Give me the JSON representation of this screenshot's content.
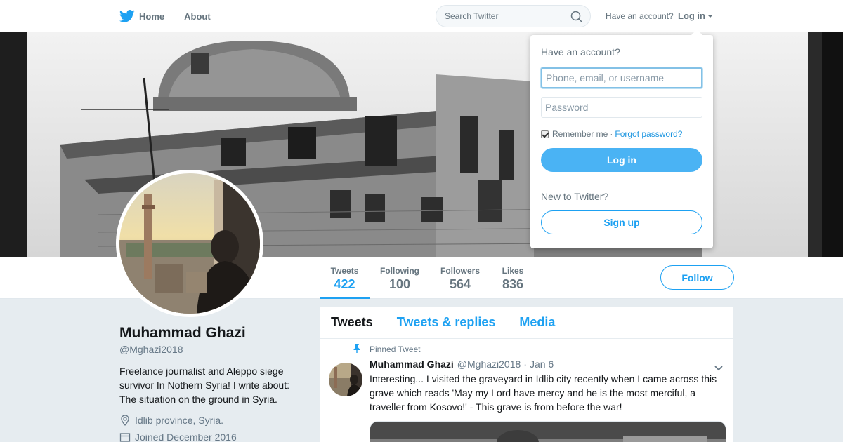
{
  "nav": {
    "home_label": "Home",
    "about_label": "About",
    "search_placeholder": "Search Twitter",
    "have_account_text": "Have an account?",
    "login_label": "Log in",
    "brand_color": "#1da1f2"
  },
  "profile": {
    "name": "Muhammad Ghazi",
    "handle": "@Mghazi2018",
    "bio": "Freelance journalist and Aleppo siege survivor In Nothern Syria! I write about: The situation on the ground in Syria.",
    "location": "Idlib province, Syria.",
    "joined": "Joined December 2016",
    "follow_label": "Follow"
  },
  "stats": [
    {
      "label": "Tweets",
      "value": "422"
    },
    {
      "label": "Following",
      "value": "100"
    },
    {
      "label": "Followers",
      "value": "564"
    },
    {
      "label": "Likes",
      "value": "836"
    }
  ],
  "timeline": {
    "tabs": [
      "Tweets",
      "Tweets & replies",
      "Media"
    ],
    "pinned_label": "Pinned Tweet",
    "tweet": {
      "name": "Muhammad Ghazi",
      "handle": "@Mghazi2018",
      "dot": "·",
      "time": "Jan 6",
      "text": "Interesting... I visited the graveyard in Idlib city recently when I came across this grave which reads 'May my Lord have mercy and he is the most merciful, a traveller from Kosovo!' - This grave is from before the war!"
    }
  },
  "login_dropdown": {
    "title": "Have an account?",
    "username_placeholder": "Phone, email, or username",
    "password_placeholder": "Password",
    "remember_label": "Remember me",
    "separator": "·",
    "forgot_label": "Forgot password?",
    "login_button": "Log in",
    "new_text": "New to Twitter?",
    "signup_button": "Sign up"
  },
  "icons": {
    "brand": "twitter-bird-icon",
    "search": "magnifier-icon",
    "location": "map-pin-icon",
    "calendar": "calendar-icon",
    "pinned": "pin-icon",
    "tweet_menu": "chevron-down-icon"
  }
}
